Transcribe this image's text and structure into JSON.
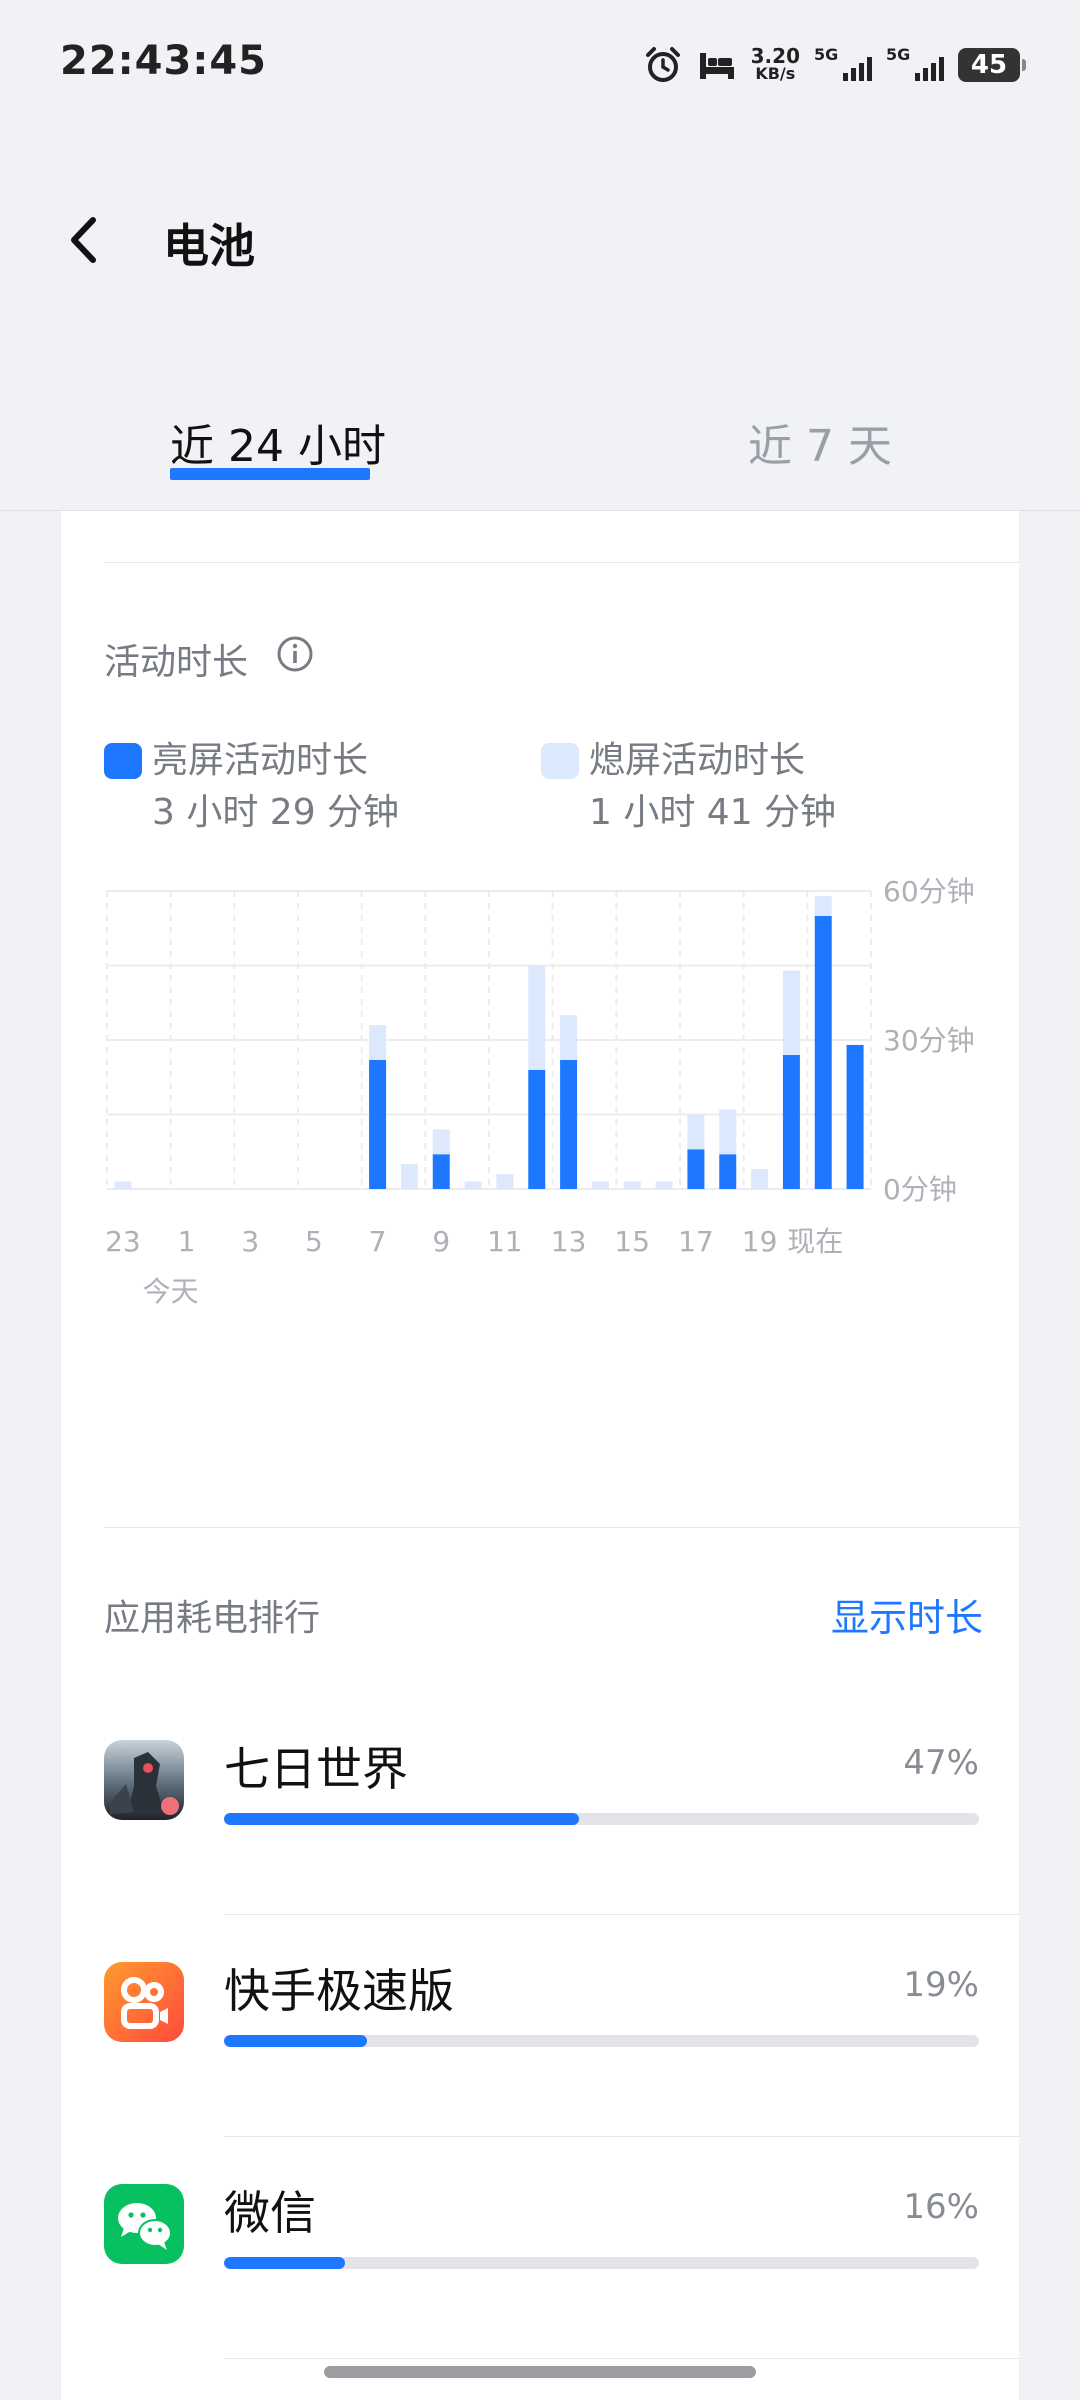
{
  "status_bar": {
    "time": "22:43:45",
    "net_speed_value": "3.20",
    "net_speed_unit": "KB/s",
    "sim1_label": "5G",
    "sim2_label": "5G",
    "battery_level": "45",
    "icons": [
      "alarm-icon",
      "bed-icon",
      "signal-icon",
      "battery-icon"
    ]
  },
  "header": {
    "title": "电池"
  },
  "tabs": [
    {
      "label": "近 24 小时",
      "active": true
    },
    {
      "label": "近 7 天",
      "active": false
    }
  ],
  "activity": {
    "title": "活动时长",
    "legend": [
      {
        "name": "亮屏活动时长",
        "value": "3 小时 29 分钟",
        "color": "#1e78ff"
      },
      {
        "name": "熄屏活动时长",
        "value": "1 小时 41 分钟",
        "color": "#dce9fd"
      }
    ]
  },
  "chart_data": {
    "type": "bar",
    "stacked": true,
    "x_tick_labels": [
      "23",
      "1",
      "3",
      "5",
      "7",
      "9",
      "11",
      "13",
      "15",
      "17",
      "19",
      "现在"
    ],
    "x_sublabel": "今天",
    "y_tick_labels": [
      "60分钟",
      "30分钟",
      "0分钟"
    ],
    "ylim": [
      0,
      60
    ],
    "grid": true,
    "series": [
      {
        "name": "亮屏活动时长",
        "color": "#1e78ff",
        "values": [
          0,
          0,
          0,
          0,
          0,
          0,
          0,
          0,
          26,
          0,
          7,
          0,
          0,
          24,
          26,
          0,
          0,
          0,
          8,
          7,
          0,
          27,
          55,
          29
        ]
      },
      {
        "name": "熄屏活动时长",
        "color": "#dce9fd",
        "values": [
          1.5,
          0,
          0,
          0,
          0,
          0,
          0,
          0,
          7,
          5,
          5,
          1.5,
          3,
          21,
          9,
          1.5,
          1.5,
          1.5,
          7,
          9,
          4,
          17,
          4,
          0
        ]
      }
    ]
  },
  "ranking": {
    "title": "应用耗电排行",
    "toggle_label": "显示时长",
    "apps": [
      {
        "name": "七日世界",
        "percent": "47%",
        "fraction": 0.47,
        "icon": "game-icon"
      },
      {
        "name": "快手极速版",
        "percent": "19%",
        "fraction": 0.19,
        "icon": "kuaishou-icon"
      },
      {
        "name": "微信",
        "percent": "16%",
        "fraction": 0.16,
        "icon": "wechat-icon"
      }
    ]
  }
}
